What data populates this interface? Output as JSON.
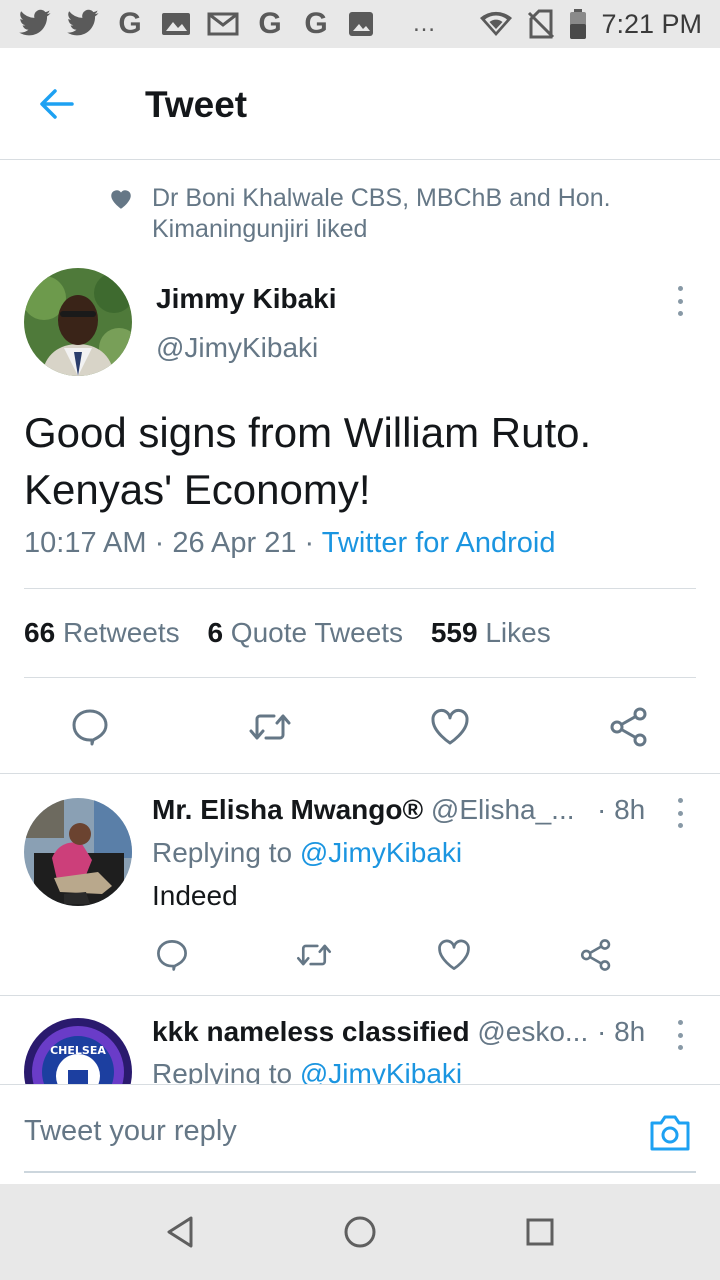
{
  "status_bar": {
    "time": "7:21 PM",
    "left_icons": [
      "twitter-icon",
      "twitter-icon",
      "google-icon",
      "gallery-icon",
      "gmail-icon",
      "google-icon",
      "google-icon",
      "image-icon"
    ],
    "more": "…"
  },
  "header": {
    "title": "Tweet"
  },
  "social_context": {
    "text": "Dr Boni Khalwale CBS, MBChB and Hon. Kimaningunjiri liked"
  },
  "tweet": {
    "author_name": "Jimmy Kibaki",
    "author_handle": "@JimyKibaki",
    "text_line1": "Good signs from William Ruto.",
    "text_line2": "Kenyas' Economy!",
    "time": "10:17 AM",
    "sep": "·",
    "date": "26 Apr 21",
    "source": "Twitter for Android",
    "retweets_count": "66",
    "retweets_label": "Retweets",
    "quotes_count": "6",
    "quotes_label": "Quote Tweets",
    "likes_count": "559",
    "likes_label": "Likes"
  },
  "replies": [
    {
      "name": "Mr. Elisha Mwango®",
      "handle": "@Elisha_...",
      "time": "· 8h",
      "replying_prefix": "Replying to",
      "replying_to": "@JimyKibaki",
      "text": "Indeed"
    },
    {
      "name": "kkk nameless classified",
      "handle": "@esko...",
      "time": "· 8h",
      "replying_prefix": "Replying to",
      "replying_to": "@JimyKibaki",
      "avatar_text": "CHELSEA"
    }
  ],
  "composer": {
    "placeholder": "Tweet your reply"
  },
  "colors": {
    "accent": "#1da1f2",
    "link": "#1b95e0",
    "secondary_text": "#657786",
    "primary_text": "#14171a",
    "divider": "#d8dde1"
  }
}
